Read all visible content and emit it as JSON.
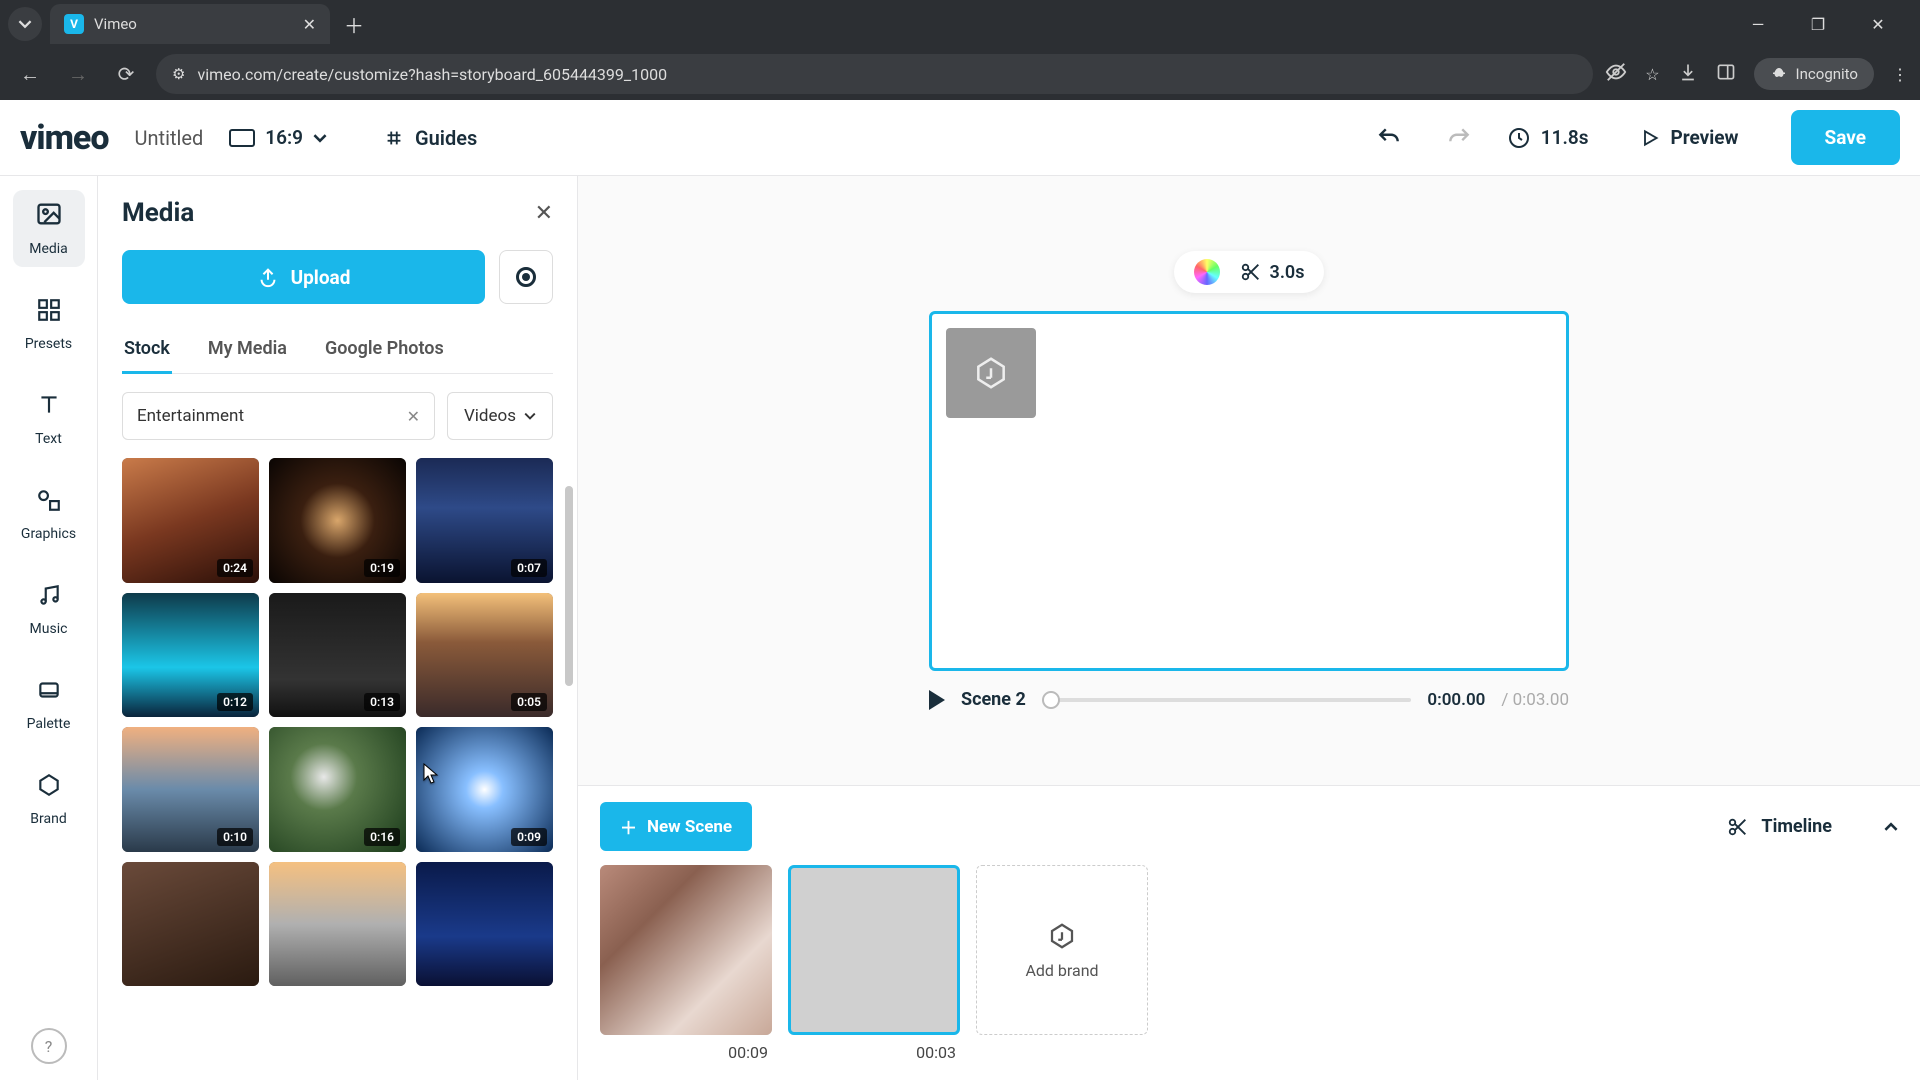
{
  "browser": {
    "tab_title": "Vimeo",
    "url": "vimeo.com/create/customize?hash=storyboard_605444399_1000",
    "incognito_label": "Incognito"
  },
  "header": {
    "logo": "vimeo",
    "title": "Untitled",
    "aspect": "16:9",
    "guides": "Guides",
    "duration": "11.8s",
    "preview": "Preview",
    "save": "Save"
  },
  "rail": {
    "items": [
      {
        "label": "Media"
      },
      {
        "label": "Presets"
      },
      {
        "label": "Text"
      },
      {
        "label": "Graphics"
      },
      {
        "label": "Music"
      },
      {
        "label": "Palette"
      },
      {
        "label": "Brand"
      }
    ]
  },
  "panel": {
    "title": "Media",
    "upload": "Upload",
    "tabs": {
      "stock": "Stock",
      "mymedia": "My Media",
      "gphotos": "Google Photos"
    },
    "search_value": "Entertainment",
    "type_label": "Videos",
    "thumbs": [
      {
        "dur": "0:24"
      },
      {
        "dur": "0:19"
      },
      {
        "dur": "0:07"
      },
      {
        "dur": "0:12"
      },
      {
        "dur": "0:13"
      },
      {
        "dur": "0:05"
      },
      {
        "dur": "0:10"
      },
      {
        "dur": "0:16"
      },
      {
        "dur": "0:09"
      },
      {
        "dur": ""
      },
      {
        "dur": ""
      },
      {
        "dur": ""
      }
    ]
  },
  "stage": {
    "trim": "3.0s",
    "scene_label": "Scene 2",
    "time_current": "0:00.00",
    "time_total": "/ 0:03.00"
  },
  "timeline": {
    "new_scene": "New Scene",
    "toggle": "Timeline",
    "scenes": [
      {
        "time": "00:09"
      },
      {
        "time": "00:03"
      }
    ],
    "add_brand": "Add brand"
  }
}
